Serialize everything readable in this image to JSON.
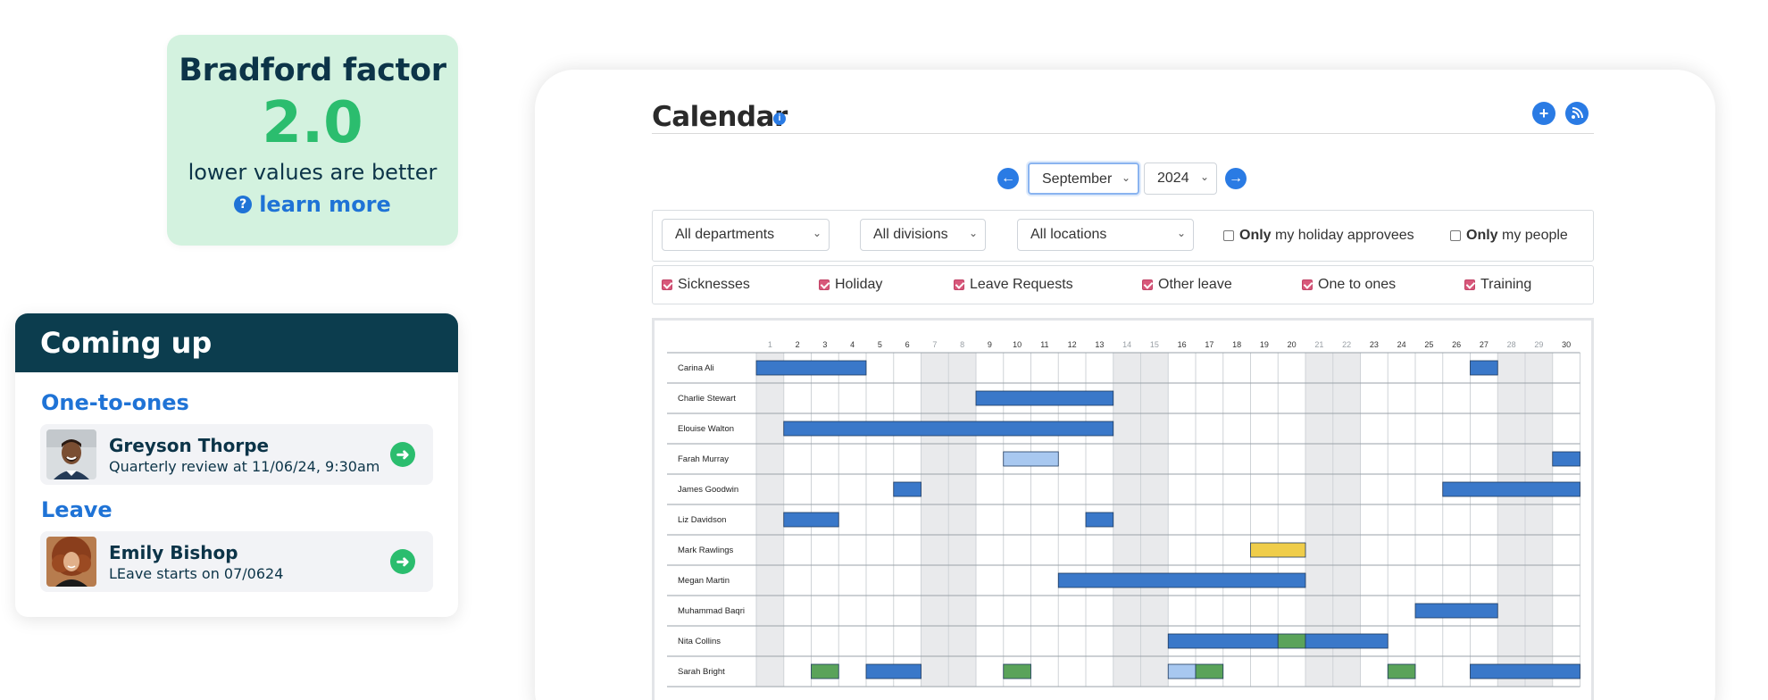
{
  "bradford": {
    "title": "Bradford factor",
    "value": "2.0",
    "hint": "lower values are better",
    "help_icon": "question-circle-icon",
    "link": "learn more"
  },
  "coming_up": {
    "title": "Coming up",
    "sections": [
      {
        "heading": "One-to-ones",
        "item": {
          "name": "Greyson Thorpe",
          "detail": "Quarterly review at 11/06/24, 9:30am",
          "action_icon": "arrow-right-icon"
        }
      },
      {
        "heading": "Leave",
        "item": {
          "name": "Emily Bishop",
          "detail": "LEave starts on 07/0624",
          "action_icon": "arrow-right-icon"
        }
      }
    ]
  },
  "calendar": {
    "title": "Calendar",
    "info_icon": "info-icon",
    "add_icon": "plus-icon",
    "feed_icon": "rss-icon",
    "prev_icon": "arrow-left-icon",
    "next_icon": "arrow-right-icon",
    "month": "September",
    "year": "2024",
    "filters": {
      "department": "All departments",
      "division": "All divisions",
      "location": "All locations",
      "approvees_bold": "Only",
      "approvees_rest": " my holiday approvees",
      "people_bold": "Only",
      "people_rest": " my people"
    },
    "types": [
      "Sicknesses",
      "Holiday",
      "Leave Requests",
      "Other leave",
      "One to ones",
      "Training"
    ],
    "days": [
      1,
      2,
      3,
      4,
      5,
      6,
      7,
      8,
      9,
      10,
      11,
      12,
      13,
      14,
      15,
      16,
      17,
      18,
      19,
      20,
      21,
      22,
      23,
      24,
      25,
      26,
      27,
      28,
      29,
      30
    ],
    "weekend_days": [
      1,
      7,
      8,
      14,
      15,
      21,
      22,
      28,
      29
    ],
    "colors": {
      "holiday": "#3a78c9",
      "request": "#a8c8f0",
      "other": "#efcd4a",
      "training": "#5aa35a",
      "weekend": "#e9eaec"
    },
    "people": [
      {
        "name": "Carina Ali",
        "bars": [
          {
            "from": 1,
            "to": 4,
            "kind": "holiday"
          },
          {
            "from": 27,
            "to": 27,
            "kind": "holiday"
          }
        ]
      },
      {
        "name": "Charlie Stewart",
        "bars": [
          {
            "from": 9,
            "to": 13,
            "kind": "holiday"
          }
        ]
      },
      {
        "name": "Elouise Walton",
        "bars": [
          {
            "from": 2,
            "to": 13,
            "kind": "holiday"
          }
        ]
      },
      {
        "name": "Farah Murray",
        "bars": [
          {
            "from": 10,
            "to": 11,
            "kind": "request"
          },
          {
            "from": 30,
            "to": 30,
            "kind": "holiday"
          }
        ]
      },
      {
        "name": "James Goodwin",
        "bars": [
          {
            "from": 6,
            "to": 6,
            "kind": "holiday"
          },
          {
            "from": 26,
            "to": 30,
            "kind": "holiday"
          }
        ]
      },
      {
        "name": "Liz Davidson",
        "bars": [
          {
            "from": 2,
            "to": 3,
            "kind": "holiday"
          },
          {
            "from": 13,
            "to": 13,
            "kind": "holiday"
          }
        ]
      },
      {
        "name": "Mark Rawlings",
        "bars": [
          {
            "from": 19,
            "to": 20,
            "kind": "other"
          }
        ]
      },
      {
        "name": "Megan Martin",
        "bars": [
          {
            "from": 12,
            "to": 20,
            "kind": "holiday"
          }
        ]
      },
      {
        "name": "Muhammad Baqri",
        "bars": [
          {
            "from": 25,
            "to": 27,
            "kind": "holiday"
          }
        ]
      },
      {
        "name": "Nita Collins",
        "bars": [
          {
            "from": 16,
            "to": 19,
            "kind": "holiday"
          },
          {
            "from": 20,
            "to": 20,
            "kind": "training"
          },
          {
            "from": 21,
            "to": 23,
            "kind": "holiday"
          }
        ]
      },
      {
        "name": "Sarah Bright",
        "bars": [
          {
            "from": 3,
            "to": 3,
            "kind": "training"
          },
          {
            "from": 5,
            "to": 6,
            "kind": "holiday"
          },
          {
            "from": 10,
            "to": 10,
            "kind": "training"
          },
          {
            "from": 16,
            "to": 16,
            "kind": "request"
          },
          {
            "from": 17,
            "to": 17,
            "kind": "training"
          },
          {
            "from": 24,
            "to": 24,
            "kind": "training"
          },
          {
            "from": 27,
            "to": 30,
            "kind": "holiday"
          }
        ]
      }
    ]
  }
}
